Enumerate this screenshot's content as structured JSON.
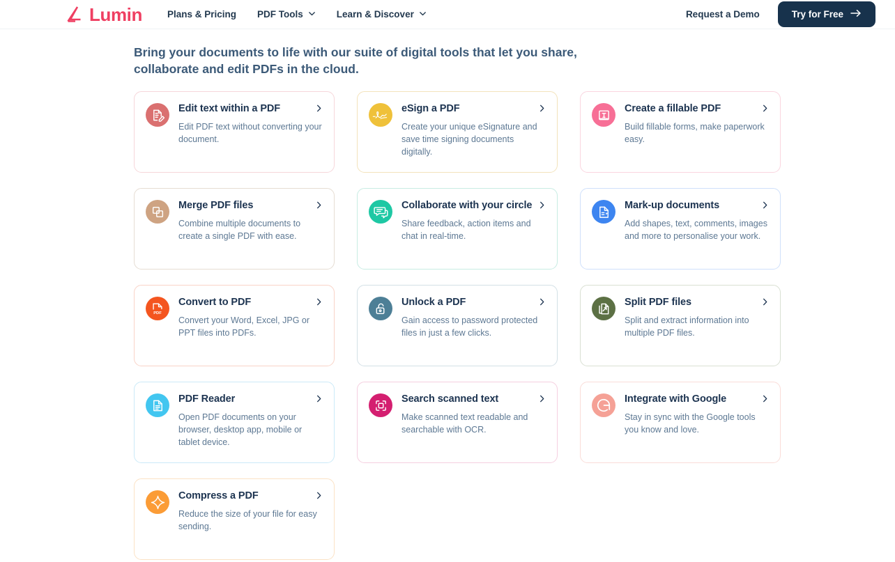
{
  "header": {
    "logo_text": "Lumin",
    "logo_icon": "lumin-logo-icon",
    "nav": [
      {
        "label": "Plans & Pricing",
        "has_caret": false
      },
      {
        "label": "PDF Tools",
        "has_caret": true
      },
      {
        "label": "Learn & Discover",
        "has_caret": true
      }
    ],
    "demo_label": "Request a Demo",
    "cta_label": "Try for Free",
    "cta_icon": "arrow-right-icon",
    "cta_bg": "#17324c"
  },
  "headline": "Bring your documents to life with our suite of digital tools that let you share, collaborate and edit PDFs in the cloud.",
  "cards": [
    {
      "title": "Edit text within a PDF",
      "desc": "Edit PDF text without converting your document.",
      "icon": "edit-document-icon",
      "icon_bg": "#da7070",
      "border": "#f6d6da"
    },
    {
      "title": "eSign a PDF",
      "desc": "Create your unique eSignature and save time signing documents digitally.",
      "icon": "esignature-icon",
      "icon_bg": "#efc13a",
      "border": "#f3e3bb"
    },
    {
      "title": "Create a fillable PDF",
      "desc": "Build fillable forms, make paperwork easy.",
      "icon": "form-field-icon",
      "icon_bg": "#f76f96",
      "border": "#fad5df"
    },
    {
      "title": "Merge PDF files",
      "desc": "Combine multiple documents to create a single PDF with ease.",
      "icon": "merge-squares-icon",
      "icon_bg": "#cea382",
      "border": "#e6ddd3"
    },
    {
      "title": "Collaborate with your circle",
      "desc": "Share feedback, action items and chat in real-time.",
      "icon": "chat-bubbles-icon",
      "icon_bg": "#1ec8a4",
      "border": "#c8ece3"
    },
    {
      "title": "Mark-up documents",
      "desc": "Add shapes, text, comments, images and more to personalise your work.",
      "icon": "markup-document-icon",
      "icon_bg": "#3d85f0",
      "border": "#cfe0fb"
    },
    {
      "title": "Convert to PDF",
      "desc": "Convert your Word, Excel, JPG or PPT files into PDFs.",
      "icon": "convert-pdf-icon",
      "icon_bg": "#f4551f",
      "border": "#f9d3c7"
    },
    {
      "title": "Unlock a PDF",
      "desc": "Gain access to password protected files in just a few clicks.",
      "icon": "unlock-padlock-icon",
      "icon_bg": "#4d7f96",
      "border": "#d3e0e6"
    },
    {
      "title": "Split PDF files",
      "desc": "Split and extract information into multiple PDF files.",
      "icon": "split-document-icon",
      "icon_bg": "#5c7044",
      "border": "#d9e0d2"
    },
    {
      "title": "PDF Reader",
      "desc": "Open PDF documents on your browser, desktop app, mobile or tablet device.",
      "icon": "reader-document-icon",
      "icon_bg": "#42c6f0",
      "border": "#cbeaf8"
    },
    {
      "title": "Search scanned text",
      "desc": "Make scanned text readable and searchable with OCR.",
      "icon": "ocr-scan-icon",
      "icon_bg": "#d41f70",
      "border": "#f5cfe0"
    },
    {
      "title": "Integrate with Google",
      "desc": "Stay in sync with the Google tools you know and love.",
      "icon": "google-g-icon",
      "icon_bg": "#f5a196",
      "border": "#fadcd8"
    },
    {
      "title": "Compress a PDF",
      "desc": "Reduce the size of your file for easy sending.",
      "icon": "compress-sparkle-icon",
      "icon_bg": "#fb9c36",
      "border": "#fbe2c5"
    }
  ]
}
